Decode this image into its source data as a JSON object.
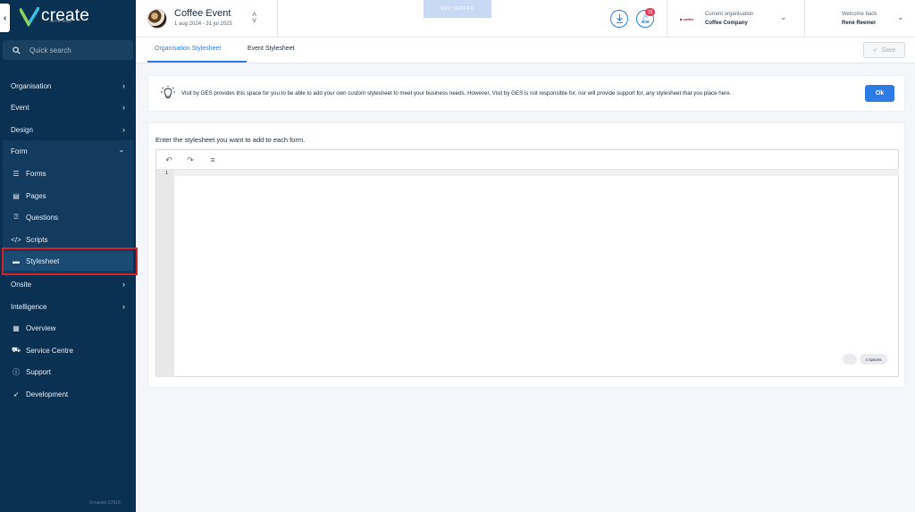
{
  "sidebar": {
    "logo_text": "create",
    "logo_sub": "WITH VISIT",
    "search_placeholder": "Quick search",
    "items": [
      {
        "label": "Organisation"
      },
      {
        "label": "Event"
      },
      {
        "label": "Design"
      },
      {
        "label": "Form"
      }
    ],
    "form_children": [
      {
        "label": "Forms"
      },
      {
        "label": "Pages"
      },
      {
        "label": "Questions"
      },
      {
        "label": "Scripts"
      },
      {
        "label": "Stylesheet"
      }
    ],
    "after": [
      {
        "label": "Onsite"
      },
      {
        "label": "Intelligence"
      },
      {
        "label": "Overview"
      },
      {
        "label": "Service Centre"
      },
      {
        "label": "Support"
      },
      {
        "label": "Development"
      }
    ],
    "version": "0-master.27816"
  },
  "header": {
    "event_title": "Coffee Event",
    "event_dates": "1 aug 2024 - 31 jul 2025",
    "dev_server": "DEV SERVER",
    "notification_count": "19",
    "org_label": "Current organisation",
    "org_name": "Coffee Company",
    "welcome_label": "Welcome back",
    "user_name": "René Reemer"
  },
  "tabs": {
    "org_stylesheet": "Organisation Stylesheet",
    "event_stylesheet": "Event Stylesheet",
    "save": "Save"
  },
  "banner": {
    "text": "Visit by GES provides this space for you to be able to add your own custom stylesheet to meet your business needs. However, Visit by GES is not responsible for, nor will provide support for, any stylesheet that you place here.",
    "ok": "Ok"
  },
  "editor": {
    "label": "Enter the stylesheet you want to add to each form.",
    "line_number": "1",
    "indent": "4 spaces"
  },
  "colors": {
    "sidebar_bg": "#0b3152",
    "accent": "#2d7be5",
    "highlight": "#d2232a"
  }
}
